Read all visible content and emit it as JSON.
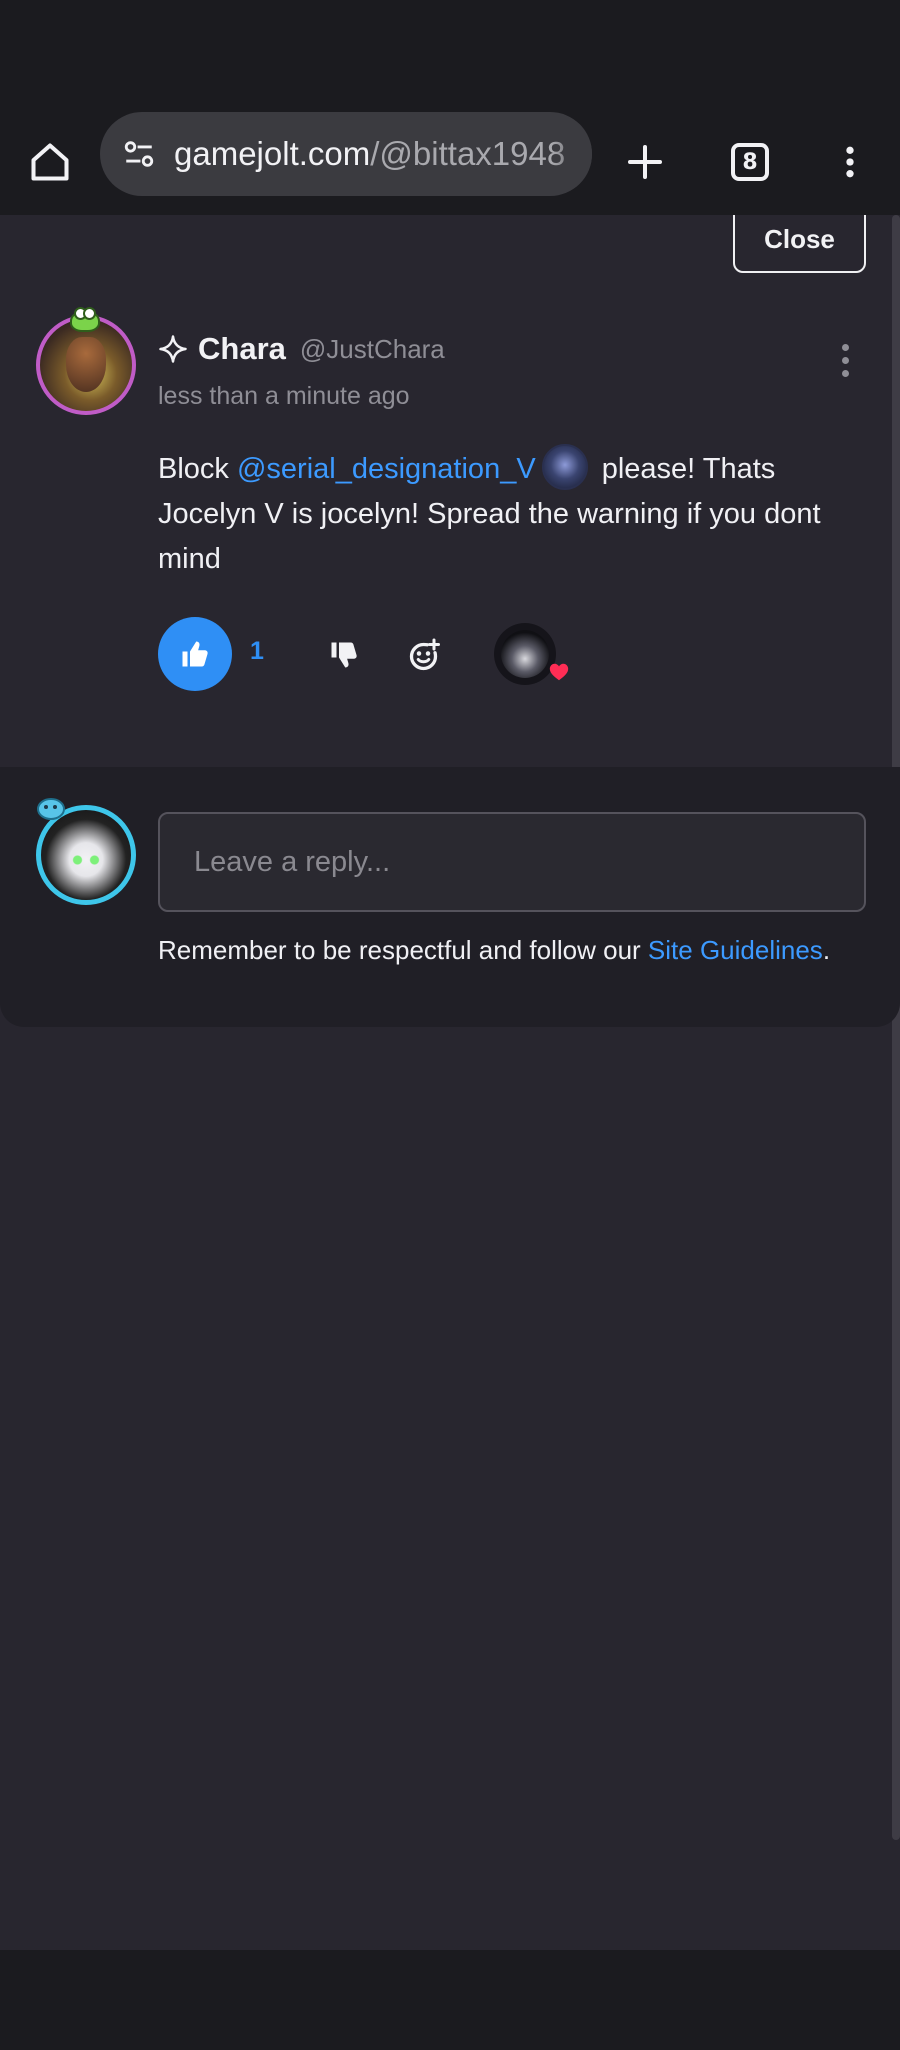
{
  "browser": {
    "url_host": "gamejolt.com",
    "url_path": "/@bittax1948",
    "tab_count": "8"
  },
  "page": {
    "close_label": "Close"
  },
  "comment": {
    "author_name": "Chara",
    "author_handle": "@JustChara",
    "timestamp": "less than a minute ago",
    "text_before": "Block ",
    "mention": "@serial_designation_V",
    "text_after": " please! Thats Jocelyn V is jocelyn! Spread the warning if you dont mind",
    "like_count": "1",
    "accent_color": "#2f8ff5"
  },
  "reply": {
    "placeholder": "Leave a reply...",
    "guidelines_text": "Remember to be respectful and follow our ",
    "guidelines_link": "Site Guidelines",
    "guidelines_end": "."
  },
  "icons": [
    "home-icon",
    "tune-icon",
    "plus-icon",
    "tabs-icon",
    "more-vert-icon",
    "sparkle-icon",
    "thumbs-up-icon",
    "thumbs-down-icon",
    "add-reaction-icon",
    "heart-icon"
  ]
}
